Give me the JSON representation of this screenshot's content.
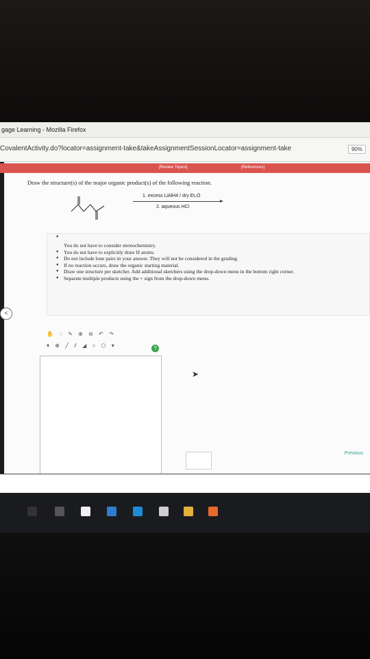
{
  "window": {
    "title": "gage Learning - Mozilla Firefox",
    "url": "CovalentActivity.do?locator=assignment-take&takeAssignmentSessionLocator=assignment-take",
    "zoom": "90%"
  },
  "tabs": [
    {
      "label": "[Review Topics]"
    },
    {
      "label": "[References]"
    }
  ],
  "question": {
    "prompt": "Draw the structure(s) of the major organic product(s) of the following reaction.",
    "conditions": [
      "1. excess LiAlH4 / dry Et₂O",
      "2. aqueous HCl"
    ],
    "notes": [
      "You do not have to consider stereochemistry.",
      "You do not have to explicitly draw H atoms.",
      "Do not include lone pairs in your answer. They will not be considered in the grading.",
      "If no reaction occurs, draw the organic starting material.",
      "Draw one structure per sketcher. Add additional sketchers using the drop-down menu in the bottom right corner.",
      "Separate multiple products using the + sign from the drop-down menu."
    ]
  },
  "ui": {
    "previous": "Previous",
    "help": "?"
  },
  "icons": {
    "left_handle": "chevron-left-icon",
    "help": "question-icon",
    "cursor": "mouse-cursor-icon"
  }
}
